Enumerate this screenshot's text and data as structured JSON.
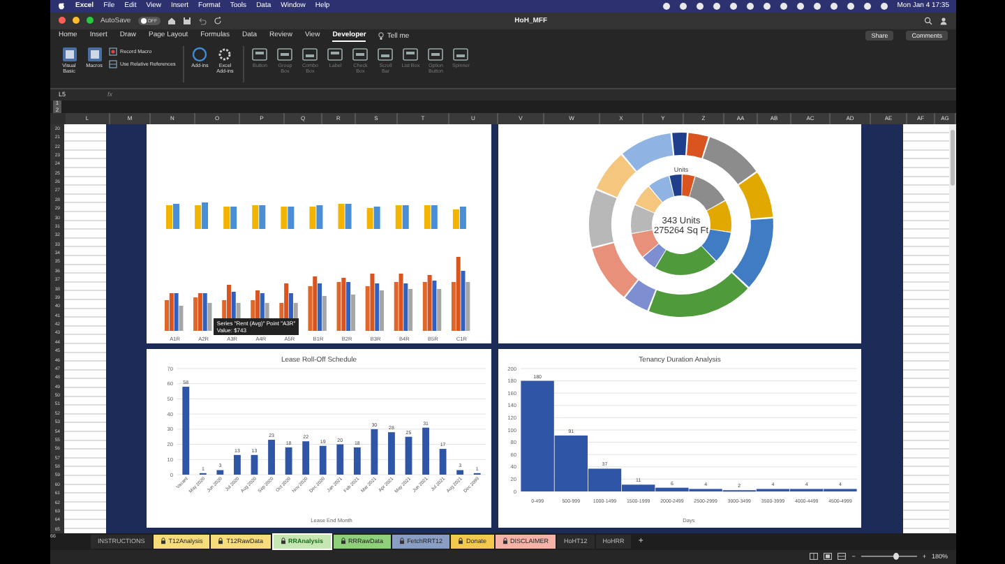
{
  "menu_bar": {
    "app": "Excel",
    "items": [
      "File",
      "Edit",
      "View",
      "Insert",
      "Format",
      "Tools",
      "Data",
      "Window",
      "Help"
    ],
    "clock": "Mon Jan 4  17:35"
  },
  "title_bar": {
    "autosave_label": "AutoSave",
    "autosave_state": "OFF",
    "autosave_on": false,
    "filename": "HoH_MFF"
  },
  "ribbon_tabs": [
    {
      "label": "Home",
      "selected": false
    },
    {
      "label": "Insert",
      "selected": false
    },
    {
      "label": "Draw",
      "selected": false
    },
    {
      "label": "Page Layout",
      "selected": false
    },
    {
      "label": "Formulas",
      "selected": false
    },
    {
      "label": "Data",
      "selected": false
    },
    {
      "label": "Review",
      "selected": false
    },
    {
      "label": "View",
      "selected": false
    },
    {
      "label": "Developer",
      "selected": true
    }
  ],
  "tell_me": "Tell me",
  "share": "Share",
  "comments": "Comments",
  "ribbon_groups": [
    {
      "items": [
        {
          "label": "Visual Basic",
          "kind": "large",
          "disabled": false
        },
        {
          "label": "Macros",
          "kind": "large",
          "disabled": false
        },
        {
          "label": "Record Macro",
          "kind": "small",
          "disabled": false
        },
        {
          "label": "Use Relative References",
          "kind": "small",
          "disabled": false
        }
      ]
    },
    {
      "items": [
        {
          "label": "Add-ins",
          "kind": "large",
          "disabled": false
        },
        {
          "label": "Excel Add-ins",
          "kind": "large",
          "disabled": false
        }
      ]
    },
    {
      "items": [
        {
          "label": "Button",
          "kind": "large",
          "disabled": true
        },
        {
          "label": "Group Box",
          "kind": "large",
          "disabled": true
        },
        {
          "label": "Combo Box",
          "kind": "large",
          "disabled": true
        },
        {
          "label": "Label",
          "kind": "large",
          "disabled": true
        },
        {
          "label": "Check Box",
          "kind": "large",
          "disabled": true
        },
        {
          "label": "Scroll Bar",
          "kind": "large",
          "disabled": true
        },
        {
          "label": "List Box",
          "kind": "large",
          "disabled": true
        },
        {
          "label": "Option Button",
          "kind": "large",
          "disabled": true
        },
        {
          "label": "Spinner",
          "kind": "large",
          "disabled": true
        }
      ]
    }
  ],
  "formula_bar": {
    "cell": "L5",
    "fx": "fx"
  },
  "outline_levels": [
    "1",
    "2"
  ],
  "columns": [
    "L",
    "M",
    "N",
    "O",
    "P",
    "Q",
    "R",
    "S",
    "T",
    "U",
    "V",
    "W",
    "X",
    "Y",
    "Z",
    "AA",
    "AB",
    "AC",
    "AD",
    "AE",
    "AF",
    "AG"
  ],
  "row_numbers": [
    "20",
    "21",
    "22",
    "23",
    "24",
    "25",
    "26",
    "27",
    "28",
    "29",
    "30",
    "31",
    "32",
    "33",
    "34",
    "35",
    "36",
    "37",
    "38",
    "39",
    "40",
    "41",
    "42",
    "43",
    "44",
    "45",
    "46",
    "47",
    "48",
    "49",
    "50",
    "51",
    "52",
    "53",
    "54",
    "55",
    "56",
    "57",
    "58",
    "59",
    "60",
    "61",
    "62",
    "63",
    "64",
    "65"
  ],
  "rent_chart": {
    "categories": [
      "A1R",
      "A2R",
      "A3R",
      "A4R",
      "A5R",
      "B1R",
      "B2R",
      "B3R",
      "B4R",
      "B5R",
      "C1R"
    ],
    "tooltip": {
      "title": "Series \"Rent (Avg)\" Point \"A3R\"",
      "value": "Value: $743"
    }
  },
  "unit_mix_chart": {
    "inner_label": "Units",
    "center_lines": [
      "343 Units",
      "275264 Sq Ft"
    ]
  },
  "lease_chart": {
    "chart_data": {
      "type": "bar",
      "title": "Lease Roll-Off Schedule",
      "xlabel": "Lease End Month",
      "categories": [
        "Vacant",
        "May 2020",
        "Jun 2020",
        "Jul 2020",
        "Aug 2020",
        "Sep 2020",
        "Oct 2020",
        "Nov 2020",
        "Dec 2020",
        "Jan 2021",
        "Feb 2021",
        "Mar 2021",
        "Apr 2021",
        "May 2021",
        "Jun 2021",
        "Jul 2021",
        "Aug 2021",
        "Dec 2099"
      ],
      "values": [
        58,
        1,
        3,
        13,
        13,
        23,
        18,
        22,
        19,
        20,
        18,
        30,
        28,
        25,
        31,
        17,
        3,
        1
      ],
      "ylim": [
        0,
        70
      ],
      "yticks": [
        0,
        10,
        20,
        30,
        40,
        50,
        60,
        70
      ],
      "grid": true,
      "data_labels": true
    }
  },
  "tenancy_chart": {
    "chart_data": {
      "type": "bar",
      "title": "Tenancy Duration Analysis",
      "xlabel": "Days",
      "categories": [
        "0-499",
        "500-999",
        "1000-1499",
        "1500-1999",
        "2000-2499",
        "2500-2999",
        "3000-3499",
        "3500-3999",
        "4000-4499",
        "4500-4999"
      ],
      "values": [
        180,
        91,
        37,
        11,
        6,
        4,
        2,
        4,
        4,
        4
      ],
      "ylim": [
        0,
        200
      ],
      "yticks": [
        0,
        20,
        40,
        60,
        80,
        100,
        120,
        140,
        160,
        180,
        200
      ],
      "grid": true,
      "data_labels": true
    }
  },
  "last_row": "66",
  "sheet_tabs": [
    {
      "label": "INSTRUCTIONS",
      "color": "#2b2b2b",
      "locked": false,
      "selected": false
    },
    {
      "label": "T12Analysis",
      "color": "#f7dc7c",
      "locked": true,
      "selected": false
    },
    {
      "label": "T12RawData",
      "color": "#f7dc7c",
      "locked": true,
      "selected": false
    },
    {
      "label": "RRAnalysis",
      "color": "#c6e7b4",
      "locked": true,
      "selected": true
    },
    {
      "label": "RRRawData",
      "color": "#8fd07a",
      "locked": true,
      "selected": false
    },
    {
      "label": "FetchRRT12",
      "color": "#8a9ec4",
      "locked": true,
      "selected": false
    },
    {
      "label": "Donate",
      "color": "#f2c94c",
      "locked": true,
      "selected": false
    },
    {
      "label": "DISCLAIMER",
      "color": "#f4b3a6",
      "locked": true,
      "selected": false
    },
    {
      "label": "HoHT12",
      "color": "#2b2b2b",
      "locked": false,
      "selected": false
    },
    {
      "label": "HoHRR",
      "color": "#2b2b2b",
      "locked": false,
      "selected": false
    }
  ],
  "add_sheet": "+",
  "zoom": {
    "level": 0.62,
    "reading": "180%",
    "minus": "−",
    "plus": "+"
  }
}
